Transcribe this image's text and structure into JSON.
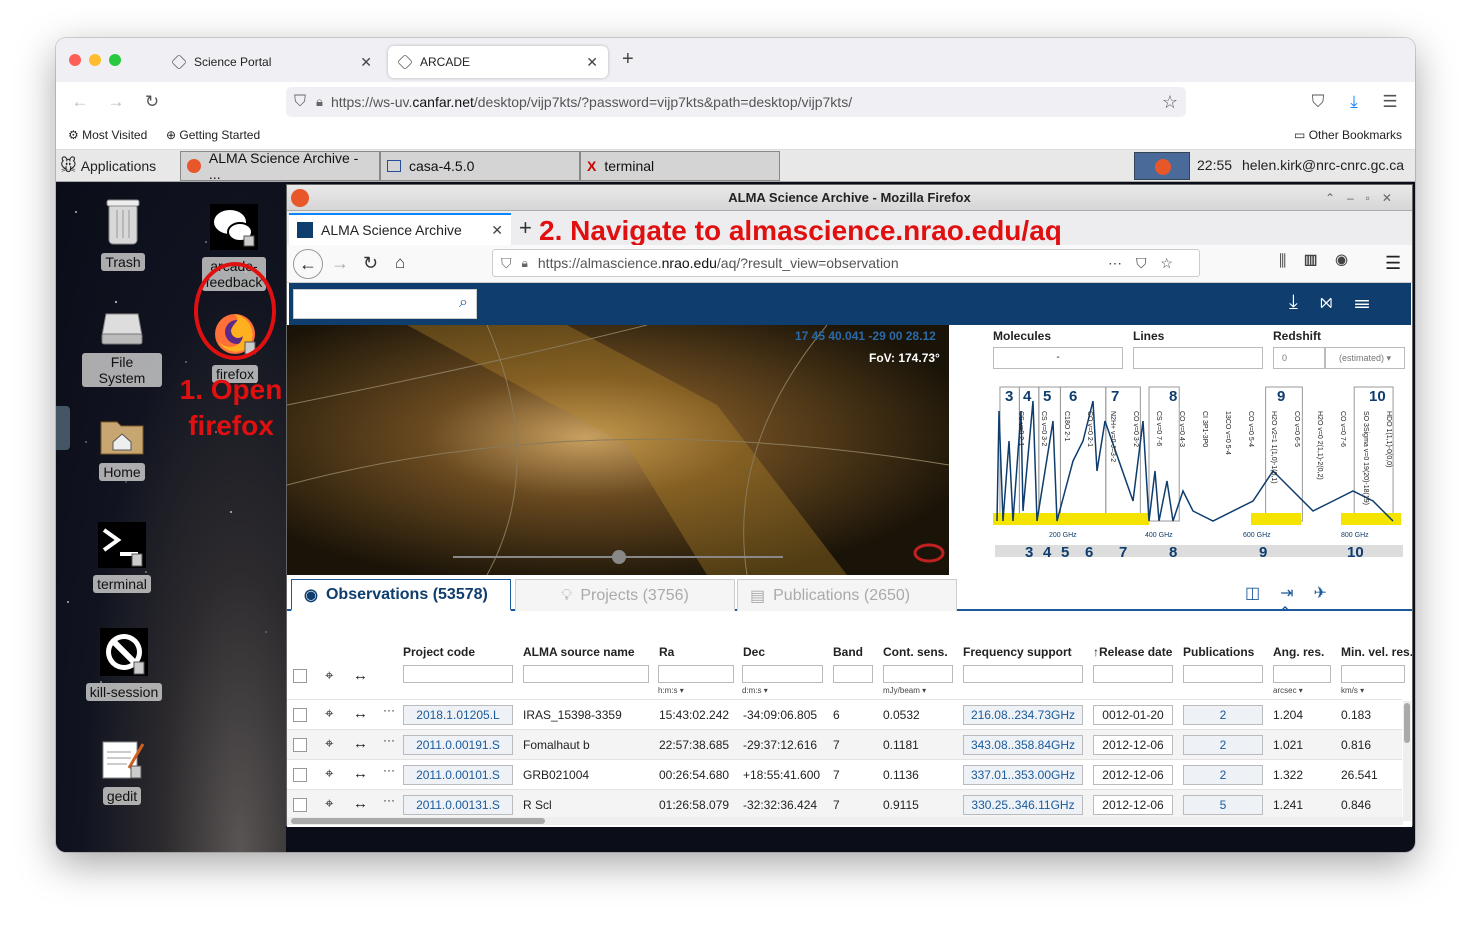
{
  "mac_tabs": [
    {
      "label": "Science Portal"
    },
    {
      "label": "ARCADE"
    }
  ],
  "mac_url": {
    "prefix": "https://ws-uv.",
    "domain": "canfar.net",
    "rest": "/desktop/vijp7kts/?password=vijp7kts&path=desktop/vijp7kts/"
  },
  "bookmarks": {
    "most_visited": "Most Visited",
    "getting_started": "Getting Started",
    "other": "Other Bookmarks"
  },
  "panel": {
    "applications": "Applications",
    "tasks": [
      "ALMA Science Archive - ...",
      "casa-4.5.0",
      "terminal"
    ],
    "time": "22:55",
    "user": "helen.kirk@nrc-cnrc.gc.ca"
  },
  "desktop_icons": {
    "trash": "Trash",
    "feedback": "arcade-\nfeedback",
    "filesystem": "File System",
    "firefox": "firefox",
    "home": "Home",
    "terminal": "terminal",
    "kill": "kill-session",
    "gedit": "gedit"
  },
  "annotations": {
    "step1_line1": "1. Open",
    "step1_line2": "firefox",
    "step2": "2. Navigate to almascience.nrao.edu/aq"
  },
  "ff": {
    "title": "ALMA Science Archive - Mozilla Firefox",
    "tab": "ALMA Science Archive",
    "url_prefix": "https://almascience.",
    "url_domain": "nrao.edu",
    "url_rest": "/aq/?result_view=observation"
  },
  "sky": {
    "coords": "17 45 40.041 -29 00 28.12",
    "fov": "FoV: 174.73°"
  },
  "spectrum": {
    "molecules": "Molecules",
    "molecules_value": "-",
    "lines": "Lines",
    "redshift": "Redshift",
    "redshift_value": "0",
    "redshift_mode": "(estimated)",
    "band_numbers": [
      "3",
      "4",
      "5",
      "6",
      "7",
      "8",
      "9",
      "10"
    ],
    "freq_labels": [
      "200 GHz",
      "400 GHz",
      "600 GHz",
      "800 GHz"
    ],
    "species": [
      "CS v=0 2-1",
      "CS v=0 3-2",
      "C18O 2-1",
      "CO v=0 2-1",
      "N2H+ v=0 J=3-2",
      "CO v=0 3-2",
      "CS v=0 7-6",
      "CO v=0 4-3",
      "CI 3P1-3P0",
      "13CO v=0 5-4",
      "CO v=0 5-4",
      "H2O v2=1 1(1,0)-1(0,1)",
      "CO v=0 6-5",
      "H2O v=0 2(1,1)-2(0,2)",
      "CO v=0 7-6",
      "SO 3Sigma v=0 19(20)-18(19)",
      "HDO 1(1,1)-0(0,0)"
    ]
  },
  "result_tabs": [
    {
      "label": "Observations",
      "count": "(53578)"
    },
    {
      "label": "Projects",
      "count": "(3756)"
    },
    {
      "label": "Publications",
      "count": "(2650)"
    }
  ],
  "columns": {
    "project": "Project code",
    "source": "ALMA source name",
    "ra": "Ra",
    "dec": "Dec",
    "band": "Band",
    "cont": "Cont. sens.",
    "freq": "Frequency support",
    "release": "↑Release date",
    "pubs": "Publications",
    "ang": "Ang. res.",
    "minvel": "Min. vel. res."
  },
  "units": {
    "ra": "h:m:s ▾",
    "dec": "d:m:s ▾",
    "cont": "mJy/beam ▾",
    "ang": "arcsec ▾",
    "minvel": "km/s ▾"
  },
  "rows": [
    {
      "project": "2018.1.01205.L",
      "source": "IRAS_15398-3359",
      "ra": "15:43:02.242",
      "dec": "-34:09:06.805",
      "band": "6",
      "cont": "0.0532",
      "freq": "216.08..234.73GHz",
      "release": "0012-01-20",
      "pubs": "2",
      "ang": "1.204",
      "minvel": "0.183"
    },
    {
      "project": "2011.0.00191.S",
      "source": "Fomalhaut b",
      "ra": "22:57:38.685",
      "dec": "-29:37:12.616",
      "band": "7",
      "cont": "0.1181",
      "freq": "343.08..358.84GHz",
      "release": "2012-12-06",
      "pubs": "2",
      "ang": "1.021",
      "minvel": "0.816"
    },
    {
      "project": "2011.0.00101.S",
      "source": "GRB021004",
      "ra": "00:26:54.680",
      "dec": "+18:55:41.600",
      "band": "7",
      "cont": "0.1136",
      "freq": "337.01..353.00GHz",
      "release": "2012-12-06",
      "pubs": "2",
      "ang": "1.322",
      "minvel": "26.541"
    },
    {
      "project": "2011.0.00131.S",
      "source": "R Scl",
      "ra": "01:26:58.079",
      "dec": "-32:32:36.424",
      "band": "7",
      "cont": "0.9115",
      "freq": "330.25..346.11GHz",
      "release": "2012-12-06",
      "pubs": "5",
      "ang": "1.241",
      "minvel": "0.846"
    }
  ],
  "colors": {
    "alma_blue": "#0e3d6e",
    "annotation_red": "#e01010",
    "band_yellow": "#f5e400"
  }
}
